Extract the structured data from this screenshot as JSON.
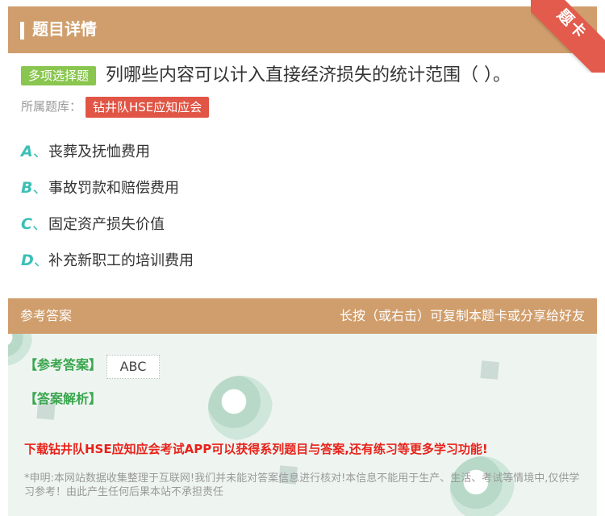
{
  "header": {
    "title": "题目详情",
    "ribbon": "题卡"
  },
  "question": {
    "type_badge": "多项选择题",
    "text": "列哪些内容可以计入直接经济损失的统计范围（ ）。",
    "bank_label": "所属题库：",
    "bank_name": "钻井队HSE应知应会"
  },
  "options": [
    {
      "letter": "A",
      "sep": "、",
      "text": "丧葬及抚恤费用"
    },
    {
      "letter": "B",
      "sep": "、",
      "text": "事故罚款和赔偿费用"
    },
    {
      "letter": "C",
      "sep": "、",
      "text": "固定资产损失价值"
    },
    {
      "letter": "D",
      "sep": "、",
      "text": "补充新职工的培训费用"
    }
  ],
  "answer": {
    "section_title": "参考答案",
    "hint": "长按（或右击）可复制本题卡或分享给好友",
    "ref_label": "【参考答案】",
    "ref_value": "ABC",
    "analysis_label": "【答案解析】",
    "promo": "下载钻井队HSE应知应会考试APP可以获得系列题目与答案,还有练习等更多学习功能!",
    "disclaimer": "*申明:本网站数据收集整理于互联网!我们并未能对答案信息进行核对!本信息不能用于生产、生活、考试等情境中,仅供学习参考！由此产生任何后果本站不承担责任"
  },
  "colors": {
    "header_bg": "#d09e6c",
    "badge_green": "#8ac64f",
    "tag_red": "#e05545",
    "option_letter": "#3cbfb6",
    "answer_label": "#3aa64e",
    "promo_red": "#e8221a"
  }
}
